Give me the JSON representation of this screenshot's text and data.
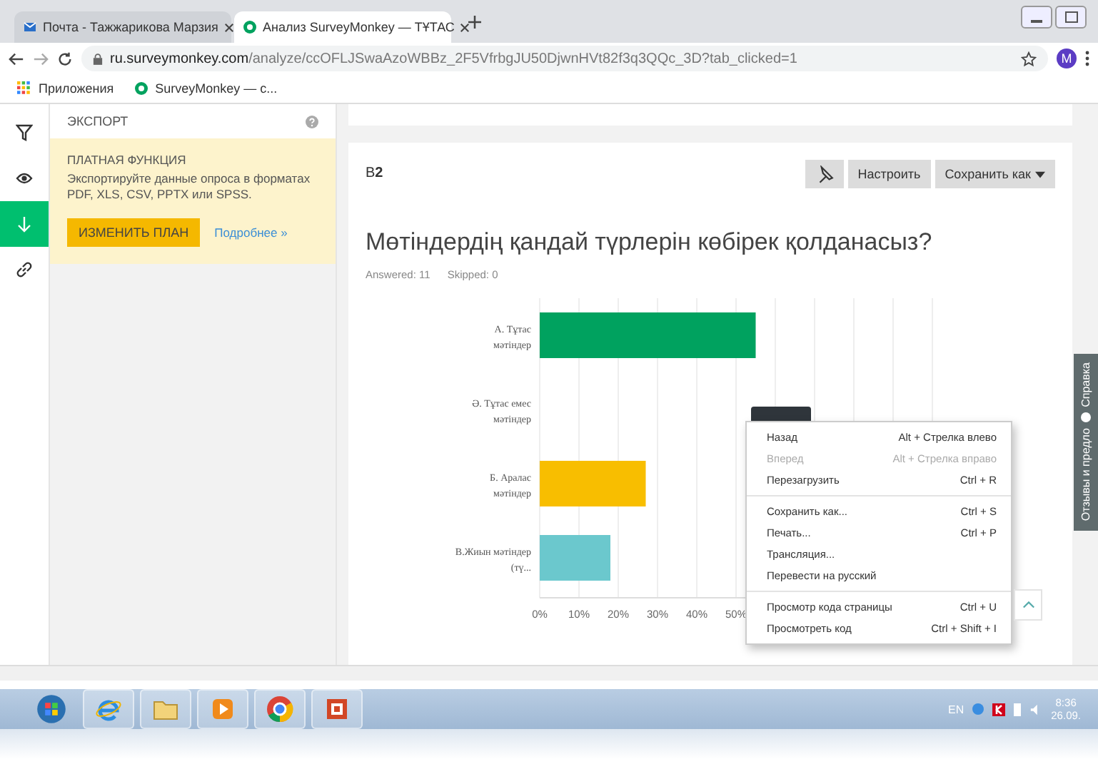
{
  "tabs": [
    {
      "title": "Почта - Тажжарикова Марзия",
      "selected": false
    },
    {
      "title": "Анализ SurveyMonkey — ТҰТАС",
      "selected": true
    }
  ],
  "address_bar": {
    "host": "ru.surveymonkey.com",
    "path": "/analyze/ccOFLJSwaAzoWBBz_2F5VfrbgJU50DjwnHVt82f3q3QQc_3D?tab_clicked=1",
    "avatar": "M"
  },
  "bookmarks": [
    {
      "label": "Приложения"
    },
    {
      "label": "SurveyMonkey — с..."
    }
  ],
  "sidebar": {
    "icons": [
      {
        "selected": false
      },
      {
        "selected": false
      },
      {
        "selected": true
      },
      {
        "selected": false
      }
    ],
    "export_title": "ЭКСПОРТ",
    "promo_title": "ПЛАТНАЯ ФУНКЦИЯ",
    "promo_text": "Экспортируйте данные опроса в форматах PDF, XLS, CSV, PPTX или SPSS.",
    "upgrade_button": "ИЗМЕНИТЬ ПЛАН",
    "more_link": "Подробнее »"
  },
  "question": {
    "number": "В**2**",
    "customize_button": "Настроить",
    "save_button": "Сохранить как",
    "title": "Мөтіндердің қандай түрлерін көбірек қолданасыз?",
    "answered": "Answered: 11",
    "skipped": "Skipped: 0",
    "chart_data": {
      "type": "bar",
      "orientation": "horizontal",
      "categories": [
        "А. Тұтас мәтіндер",
        "Ә. Тұтас емес мәтіндер",
        "Б. Аралас мәтіндер",
        "В.Жиын мәтіндер (тү..."
      ],
      "series": [
        {
          "color": "#00a25f",
          "values": [
            55,
            0,
            null,
            null
          ]
        },
        {
          "color": "#f8be00",
          "values": [
            null,
            null,
            27,
            null
          ]
        },
        {
          "color": "#6bc8cd",
          "values": [
            null,
            null,
            null,
            18
          ]
        }
      ],
      "stacked": true,
      "grid": true,
      "xlim": [
        0,
        100
      ],
      "xticks": [
        {
          "value": 0,
          "label": "0%"
        },
        {
          "value": 10,
          "label": "10%"
        },
        {
          "value": 20,
          "label": "20%"
        },
        {
          "value": 30,
          "label": "30%"
        },
        {
          "value": 40,
          "label": "40%"
        },
        {
          "value": 50,
          "label": "50%"
        }
      ]
    }
  },
  "context_menu": [
    {
      "kind": "item",
      "label": "Назад",
      "shortcut": "Alt + Стрелка влево",
      "disabled": false
    },
    {
      "kind": "item",
      "label": "Вперед",
      "shortcut": "Alt + Стрелка вправо",
      "disabled": true
    },
    {
      "kind": "item",
      "label": "Перезагрузить",
      "shortcut": "Ctrl + R",
      "disabled": false
    },
    {
      "kind": "separator"
    },
    {
      "kind": "item",
      "label": "Сохранить как...",
      "shortcut": "Ctrl + S",
      "disabled": false
    },
    {
      "kind": "item",
      "label": "Печать...",
      "shortcut": "Ctrl + P",
      "disabled": false
    },
    {
      "kind": "item",
      "label": "Трансляция...",
      "disabled": false
    },
    {
      "kind": "item",
      "label": "Перевести на русский",
      "disabled": false
    },
    {
      "kind": "separator"
    },
    {
      "kind": "item",
      "label": "Просмотр кода страницы",
      "shortcut": "Ctrl + U",
      "disabled": false
    },
    {
      "kind": "item",
      "label": "Просмотреть код",
      "shortcut": "Ctrl + Shift + I",
      "disabled": false
    }
  ],
  "help_tab": {
    "feedback": "Отзывы и предло",
    "help": "Справка"
  },
  "taskbar": {
    "language": "EN",
    "time": "8:36",
    "date": "26.09."
  }
}
